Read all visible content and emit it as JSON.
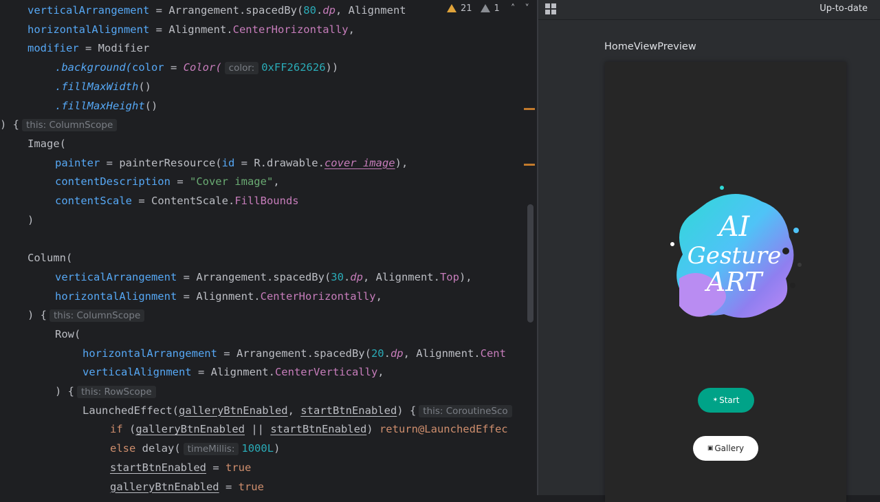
{
  "editor": {
    "lines": [
      {
        "indent": 1,
        "tokens": [
          {
            "t": "verticalArrangement",
            "c": "param"
          },
          {
            "t": " = ",
            "c": "punc"
          },
          {
            "t": "Arrangement.spacedBy(",
            "c": "plain"
          },
          {
            "t": "80",
            "c": "num"
          },
          {
            "t": ".",
            "c": "plain"
          },
          {
            "t": "dp",
            "c": "ital"
          },
          {
            "t": ", Alignment",
            "c": "plain"
          }
        ]
      },
      {
        "indent": 1,
        "tokens": [
          {
            "t": "horizontalAlignment",
            "c": "param"
          },
          {
            "t": " = ",
            "c": "punc"
          },
          {
            "t": "Alignment.",
            "c": "plain"
          },
          {
            "t": "CenterHorizontally",
            "c": "prop"
          },
          {
            "t": ",",
            "c": "punc"
          }
        ]
      },
      {
        "indent": 1,
        "tokens": [
          {
            "t": "modifier",
            "c": "param"
          },
          {
            "t": " = ",
            "c": "punc"
          },
          {
            "t": "Modifier",
            "c": "plain"
          }
        ]
      },
      {
        "indent": 2,
        "tokens": [
          {
            "t": ".background(",
            "c": "ext"
          },
          {
            "t": "color",
            "c": "param"
          },
          {
            "t": " = ",
            "c": "punc"
          },
          {
            "t": "Color(",
            "c": "ital"
          },
          {
            "hint": "color:"
          },
          {
            "t": "0xFF262626",
            "c": "num"
          },
          {
            "t": "))",
            "c": "punc"
          }
        ]
      },
      {
        "indent": 2,
        "tokens": [
          {
            "t": ".fillMaxWidth",
            "c": "ext"
          },
          {
            "t": "()",
            "c": "punc"
          }
        ]
      },
      {
        "indent": 2,
        "tokens": [
          {
            "t": ".fillMaxHeight",
            "c": "ext"
          },
          {
            "t": "()",
            "c": "punc"
          }
        ]
      },
      {
        "indent": 0,
        "tokens": [
          {
            "t": ") {",
            "c": "punc"
          },
          {
            "hint": "this: ColumnScope"
          }
        ]
      },
      {
        "indent": 1,
        "tokens": [
          {
            "t": "Image(",
            "c": "plain"
          }
        ]
      },
      {
        "indent": 2,
        "tokens": [
          {
            "t": "painter",
            "c": "param"
          },
          {
            "t": " = ",
            "c": "punc"
          },
          {
            "t": "painterResource(",
            "c": "plain"
          },
          {
            "t": "id",
            "c": "param"
          },
          {
            "t": " = ",
            "c": "punc"
          },
          {
            "t": "R.drawable.",
            "c": "plain"
          },
          {
            "t": "cover_image",
            "c": "uli"
          },
          {
            "t": "),",
            "c": "punc"
          }
        ]
      },
      {
        "indent": 2,
        "tokens": [
          {
            "t": "contentDescription",
            "c": "param"
          },
          {
            "t": " = ",
            "c": "punc"
          },
          {
            "t": "\"Cover image\"",
            "c": "str"
          },
          {
            "t": ",",
            "c": "punc"
          }
        ]
      },
      {
        "indent": 2,
        "tokens": [
          {
            "t": "contentScale",
            "c": "param"
          },
          {
            "t": " = ",
            "c": "punc"
          },
          {
            "t": "ContentScale.",
            "c": "plain"
          },
          {
            "t": "FillBounds",
            "c": "prop"
          }
        ]
      },
      {
        "indent": 1,
        "tokens": [
          {
            "t": ")",
            "c": "punc"
          }
        ]
      },
      {
        "indent": 1,
        "tokens": []
      },
      {
        "indent": 1,
        "tokens": [
          {
            "t": "Column(",
            "c": "plain"
          }
        ]
      },
      {
        "indent": 2,
        "tokens": [
          {
            "t": "verticalArrangement",
            "c": "param"
          },
          {
            "t": " = ",
            "c": "punc"
          },
          {
            "t": "Arrangement.spacedBy(",
            "c": "plain"
          },
          {
            "t": "30",
            "c": "num"
          },
          {
            "t": ".",
            "c": "plain"
          },
          {
            "t": "dp",
            "c": "ital"
          },
          {
            "t": ", Alignment.",
            "c": "plain"
          },
          {
            "t": "Top",
            "c": "prop"
          },
          {
            "t": "),",
            "c": "punc"
          }
        ]
      },
      {
        "indent": 2,
        "tokens": [
          {
            "t": "horizontalAlignment",
            "c": "param"
          },
          {
            "t": " = ",
            "c": "punc"
          },
          {
            "t": "Alignment.",
            "c": "plain"
          },
          {
            "t": "CenterHorizontally",
            "c": "prop"
          },
          {
            "t": ",",
            "c": "punc"
          }
        ]
      },
      {
        "indent": 1,
        "tokens": [
          {
            "t": ") {",
            "c": "punc"
          },
          {
            "hint": "this: ColumnScope"
          }
        ]
      },
      {
        "indent": 2,
        "tokens": [
          {
            "t": "Row(",
            "c": "plain"
          }
        ]
      },
      {
        "indent": 3,
        "tokens": [
          {
            "t": "horizontalArrangement",
            "c": "param"
          },
          {
            "t": " = ",
            "c": "punc"
          },
          {
            "t": "Arrangement.spacedBy(",
            "c": "plain"
          },
          {
            "t": "20",
            "c": "num"
          },
          {
            "t": ".",
            "c": "plain"
          },
          {
            "t": "dp",
            "c": "ital"
          },
          {
            "t": ", Alignment.",
            "c": "plain"
          },
          {
            "t": "Cent",
            "c": "prop"
          }
        ]
      },
      {
        "indent": 3,
        "tokens": [
          {
            "t": "verticalAlignment",
            "c": "param"
          },
          {
            "t": " = ",
            "c": "punc"
          },
          {
            "t": "Alignment.",
            "c": "plain"
          },
          {
            "t": "CenterVertically",
            "c": "prop"
          },
          {
            "t": ",",
            "c": "punc"
          }
        ]
      },
      {
        "indent": 2,
        "tokens": [
          {
            "t": ") {",
            "c": "punc"
          },
          {
            "hint": "this: RowScope"
          }
        ]
      },
      {
        "indent": 3,
        "tokens": [
          {
            "t": "LaunchedEffect(",
            "c": "plain"
          },
          {
            "t": "galleryBtnEnabled",
            "c": "ul"
          },
          {
            "t": ", ",
            "c": "punc"
          },
          {
            "t": "startBtnEnabled",
            "c": "ul"
          },
          {
            "t": ") {",
            "c": "punc"
          },
          {
            "hint": "this: CoroutineSco"
          }
        ]
      },
      {
        "indent": 4,
        "tokens": [
          {
            "t": "if",
            "c": "kw"
          },
          {
            "t": " (",
            "c": "punc"
          },
          {
            "t": "galleryBtnEnabled",
            "c": "ul"
          },
          {
            "t": " || ",
            "c": "punc"
          },
          {
            "t": "startBtnEnabled",
            "c": "ul"
          },
          {
            "t": ") ",
            "c": "punc"
          },
          {
            "t": "return",
            "c": "kw"
          },
          {
            "t": "@LaunchedEffec",
            "c": "kw"
          }
        ]
      },
      {
        "indent": 4,
        "tokens": [
          {
            "t": "else",
            "c": "kw"
          },
          {
            "t": " delay(",
            "c": "plain"
          },
          {
            "hint": "timeMillis:"
          },
          {
            "t": "1000L",
            "c": "num"
          },
          {
            "t": ")",
            "c": "punc"
          }
        ]
      },
      {
        "indent": 4,
        "tokens": [
          {
            "t": "startBtnEnabled",
            "c": "ul"
          },
          {
            "t": " = ",
            "c": "punc"
          },
          {
            "t": "true",
            "c": "kw"
          }
        ]
      },
      {
        "indent": 4,
        "tokens": [
          {
            "t": "galleryBtnEnabled",
            "c": "ul"
          },
          {
            "t": " = ",
            "c": "punc"
          },
          {
            "t": "true",
            "c": "kw"
          }
        ]
      }
    ]
  },
  "inspections": {
    "warnings": "21",
    "weak_warnings": "1",
    "prev_icon": "chevron-up-icon",
    "next_icon": "chevron-down-icon"
  },
  "preview": {
    "status": "Up-to-date",
    "title": "HomeViewPreview",
    "cover": {
      "line1": "AI",
      "line2": "Gesture",
      "line3": "ART"
    },
    "start_button": {
      "label": "Start",
      "icon": "sparkle-icon"
    },
    "gallery_button": {
      "label": "Gallery",
      "icon": "image-icon"
    }
  },
  "colors": {
    "editor_bg": "#1e1f22",
    "panel_bg": "#2b2d30",
    "phone_bg": "#262626",
    "start_btn": "#00a388",
    "gallery_btn": "#ffffff"
  }
}
